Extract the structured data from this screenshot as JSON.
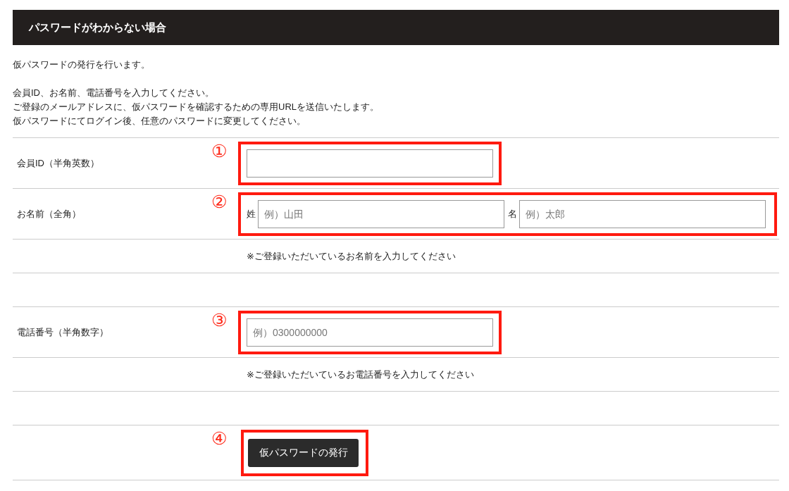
{
  "header": {
    "title": "パスワードがわからない場合"
  },
  "intro": [
    "仮パスワードの発行を行います。",
    "会員ID、お名前、電話番号を入力してください。",
    "ご登録のメールアドレスに、仮パスワードを確認するための専用URLを送信いたします。",
    "仮パスワードにてログイン後、任意のパスワードに変更してください。"
  ],
  "rows": [
    {
      "kind": "text-field",
      "label": "会員ID（半角英数）",
      "callout": "①"
    },
    {
      "kind": "name-fields",
      "label": "お名前（全角）",
      "callout": "②",
      "inputs": [
        {
          "prefix": "姓",
          "placeholder": "例）山田"
        },
        {
          "prefix": "名",
          "placeholder": "例）太郎"
        }
      ]
    },
    {
      "kind": "note",
      "text": "※ご登録いただいているお名前を入力してください"
    },
    {
      "kind": "spacer"
    },
    {
      "kind": "text-field",
      "label": "電話番号（半角数字）",
      "callout": "③",
      "placeholder": "例）0300000000"
    },
    {
      "kind": "note",
      "text": "※ご登録いただいているお電話番号を入力してください"
    },
    {
      "kind": "spacer"
    },
    {
      "kind": "button",
      "callout": "④",
      "button": "仮パスワードの発行"
    }
  ]
}
